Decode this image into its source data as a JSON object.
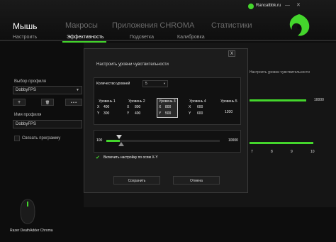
{
  "header": {
    "tabs": [
      {
        "label": "Мышь"
      },
      {
        "label": "Макросы"
      },
      {
        "label": "Приложения CHROMA"
      },
      {
        "label": "Статистики"
      }
    ],
    "account": "Rancalbbk.ru",
    "sub_tabs": [
      "Настроить",
      "Эффективность",
      "Подсветка",
      "Калибровка"
    ]
  },
  "left": {
    "profile_label": "Выбор профиля",
    "profile_value": "DobbyFPS",
    "add_btn": "+",
    "trash_btn": "🗑",
    "more_btn": "• • •",
    "name_label": "Имя профиля",
    "name_value": "DobbyFPS",
    "link_label": "Связать программу",
    "device_name": "Razer DeathAdder Chroma"
  },
  "background": {
    "section_label": "Настроить уровни чувствительности",
    "max_value": "10000",
    "ticks": [
      "7",
      "8",
      "9",
      "10"
    ]
  },
  "dialog": {
    "title": "Настроить уровни чувствительности",
    "close": "X",
    "count_label": "Количество уровней",
    "count_value": "5",
    "levels": [
      {
        "name": "Уровень 1",
        "x": "400",
        "y": "300"
      },
      {
        "name": "Уровень 2",
        "x": "800",
        "y": "400"
      },
      {
        "name": "Уровень 3",
        "x": "800",
        "y": "500"
      },
      {
        "name": "Уровень 4",
        "x": "600",
        "y": "600"
      },
      {
        "name": "Уровень 5",
        "single": "1200"
      }
    ],
    "x_label": "X",
    "y_label": "Y",
    "slider_min": "100",
    "slider_max": "10000",
    "slider_fraction": 0.12,
    "xy_label": "Включить настройку по осям X-Y",
    "save": "Сохранить",
    "cancel": "Отмена"
  }
}
